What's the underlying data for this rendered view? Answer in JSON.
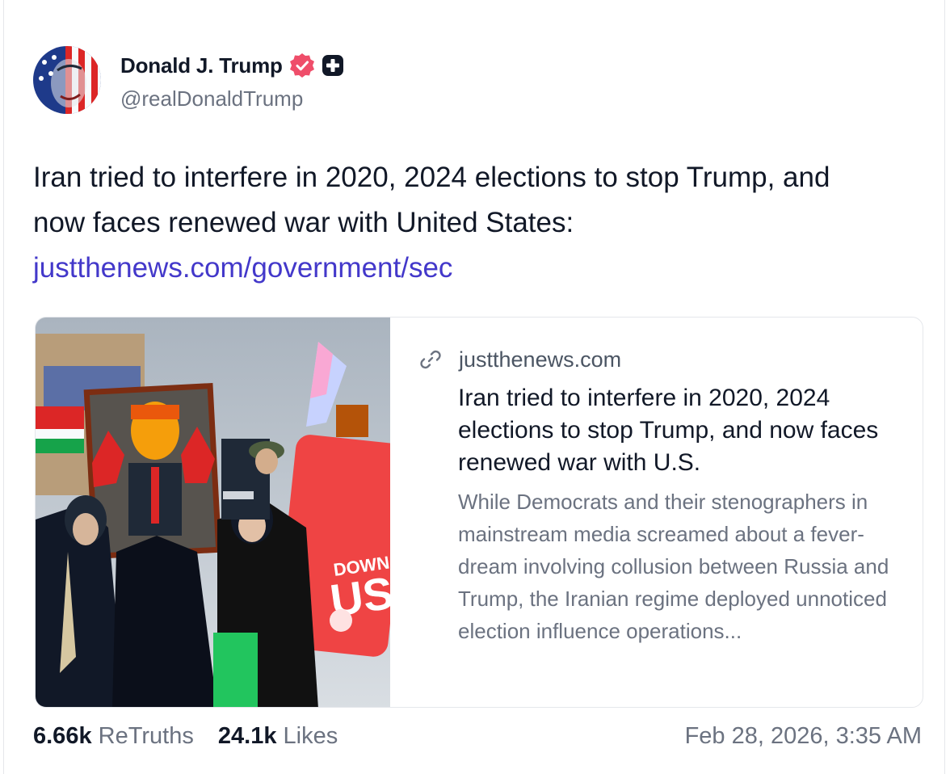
{
  "author": {
    "name": "Donald J. Trump",
    "handle": "@realDonaldTrump",
    "verified_icon": "verified-badge-icon",
    "plus_icon": "plus-badge-icon",
    "verified_color": "#ef4e6a"
  },
  "post": {
    "text_lines": [
      "Iran tried to interfere in 2020, 2024 elections to stop Trump, and",
      "now faces renewed war with United States:"
    ],
    "link_text": "justthenews.com/government/sec",
    "link_color": "#4338ca"
  },
  "link_card": {
    "domain": "justthenews.com",
    "title": "Iran tried to interfere in 2020, 2024 elections to stop Trump, and now faces renewed war with U.S.",
    "description": "While Democrats and their stenographers in mainstream media screamed about a fever-dream involving collusion between Russia and Trump, the Iranian regime deployed unnoticed election influence operations...",
    "image_sign_text_1": "DOWN WITH",
    "image_sign_text_2": "US",
    "link_icon": "link-chain-icon"
  },
  "stats": {
    "retruths_count": "6.66k",
    "retruths_label": "ReTruths",
    "likes_count": "24.1k",
    "likes_label": "Likes"
  },
  "timestamp": "Feb 28, 2026, 3:35 AM"
}
